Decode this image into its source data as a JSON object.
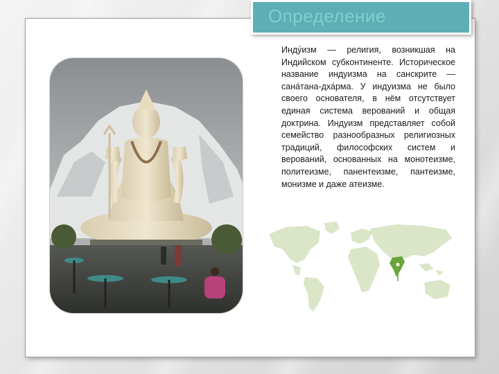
{
  "slide": {
    "title": "Определение",
    "body": "Инду́изм — религия, возникшая на Индийском субконтиненте. Историческое название индуизма на санскрите — сана́тана-дха́рма. У индуизма не было своего основателя, в нём отсутствует единая система верований и общая доктрина. Индуизм представляет собой семейство разнообразных религиозных традиций, философских систем и верований, основанных на монотеизме, политеизме, панентеизме, пантеизме, монизме и даже атеизме.",
    "map_label": "Индия"
  },
  "colors": {
    "title_bg": "#5eaeb5",
    "title_text": "#7fd0d0",
    "map_land": "#dbe6c8",
    "map_highlight": "#6aa53c"
  }
}
